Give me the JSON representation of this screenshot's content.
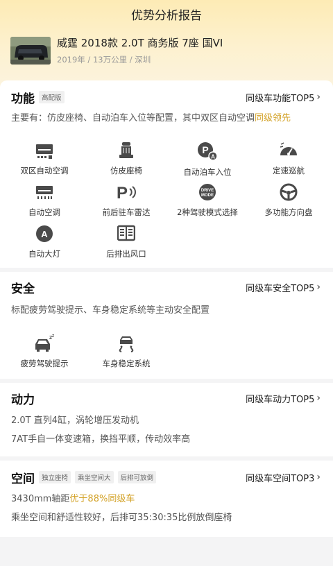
{
  "header": {
    "title": "优势分析报告"
  },
  "car": {
    "name": "威霆 2018款 2.0T 商务版 7座 国VI",
    "meta": "2019年 / 13万公里 / 深圳"
  },
  "sections": {
    "function": {
      "title": "功能",
      "chip": "高配版",
      "top_link": "同级车功能TOP5",
      "desc_prefix": "主要有：仿皮座椅、自动泊车入位等配置，其中双区自动空调",
      "desc_highlight": "同级领先",
      "features": [
        {
          "label": "双区自动空调",
          "icon": "ac-dual-icon"
        },
        {
          "label": "仿皮座椅",
          "icon": "seat-icon"
        },
        {
          "label": "自动泊车入位",
          "icon": "auto-park-icon"
        },
        {
          "label": "定速巡航",
          "icon": "cruise-icon"
        },
        {
          "label": "自动空调",
          "icon": "ac-icon"
        },
        {
          "label": "前后驻车雷达",
          "icon": "parking-radar-icon"
        },
        {
          "label": "2种驾驶模式选择",
          "icon": "drive-mode-icon"
        },
        {
          "label": "多功能方向盘",
          "icon": "steering-wheel-icon"
        },
        {
          "label": "自动大灯",
          "icon": "auto-headlight-icon"
        },
        {
          "label": "后排出风口",
          "icon": "rear-vent-icon"
        }
      ]
    },
    "safety": {
      "title": "安全",
      "top_link": "同级车安全TOP5",
      "desc": "标配疲劳驾驶提示、车身稳定系统等主动安全配置",
      "features": [
        {
          "label": "疲劳驾驶提示",
          "icon": "fatigue-warning-icon"
        },
        {
          "label": "车身稳定系统",
          "icon": "stability-control-icon"
        }
      ]
    },
    "power": {
      "title": "动力",
      "top_link": "同级车动力TOP5",
      "lines": [
        "2.0T 直列4缸，涡轮增压发动机",
        "7AT手自一体变速箱，换挡平顺，传动效率高"
      ]
    },
    "space": {
      "title": "空间",
      "chips": [
        "独立座椅",
        "乘坐空间大",
        "后排可放倒"
      ],
      "top_link": "同级车空间TOP3",
      "line1_prefix": "3430mm轴距",
      "line1_highlight": "优于88%同级车",
      "line2": "乘坐空间和舒适性较好，后排可35:30:35比例放倒座椅"
    }
  },
  "colors": {
    "highlight": "#d3a227",
    "icon": "#4a4a4a",
    "hero_top": "#fdebb5"
  },
  "chevron": "›"
}
